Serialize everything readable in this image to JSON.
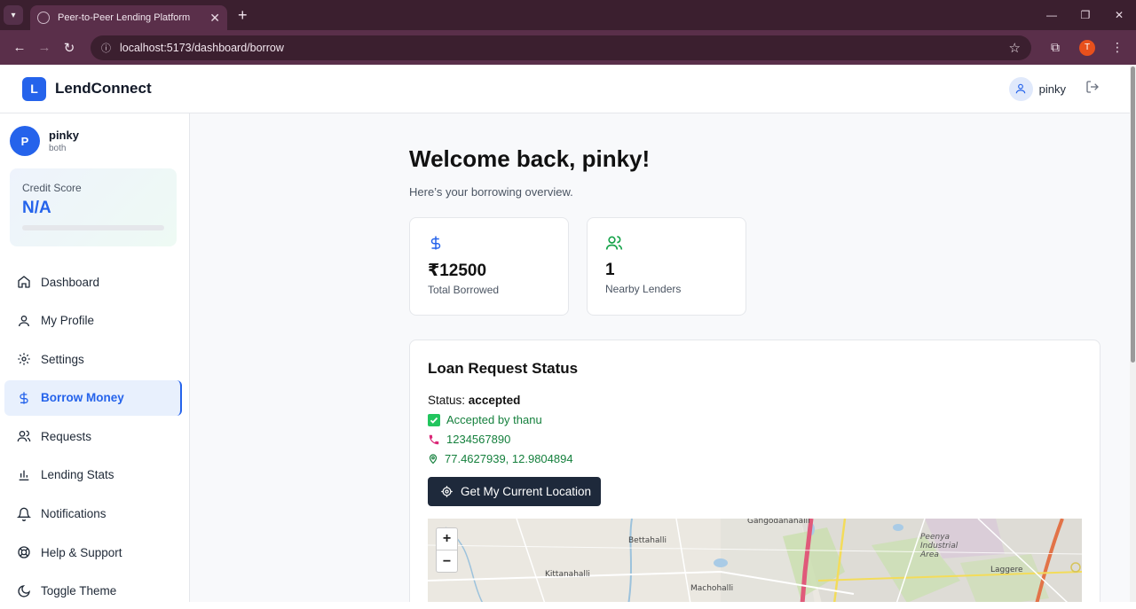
{
  "browser": {
    "tab_title": "Peer-to-Peer Lending Platform",
    "url": "localhost:5173/dashboard/borrow",
    "profile_initial": "T"
  },
  "topnav": {
    "logo_letter": "L",
    "brand": "LendConnect",
    "username": "pinky"
  },
  "sidebar": {
    "avatar_initial": "P",
    "username": "pinky",
    "role": "both",
    "credit": {
      "label": "Credit Score",
      "value": "N/A",
      "fill_fraction": 0
    },
    "items": [
      {
        "label": "Dashboard",
        "icon": "home-icon"
      },
      {
        "label": "My Profile",
        "icon": "user-icon"
      },
      {
        "label": "Settings",
        "icon": "gear-icon"
      },
      {
        "label": "Borrow Money",
        "icon": "dollar-icon"
      },
      {
        "label": "Requests",
        "icon": "users-icon"
      },
      {
        "label": "Lending Stats",
        "icon": "bar-chart-icon"
      },
      {
        "label": "Notifications",
        "icon": "bell-icon"
      },
      {
        "label": "Help & Support",
        "icon": "lifebuoy-icon"
      },
      {
        "label": "Toggle Theme",
        "icon": "moon-icon"
      }
    ],
    "active_item": "Borrow Money"
  },
  "main": {
    "welcome": "Welcome back, pinky!",
    "subtitle": "Here’s your borrowing overview.",
    "stats": [
      {
        "value": "₹12500",
        "label": "Total Borrowed",
        "icon": "dollar-icon",
        "color": "#2563eb"
      },
      {
        "value": "1",
        "label": "Nearby Lenders",
        "icon": "users-icon",
        "color": "#16a34a"
      }
    ],
    "loan_status": {
      "title": "Loan Request Status",
      "status_prefix": "Status:",
      "status_value": "accepted",
      "accepted_by": "Accepted by thanu",
      "phone": "1234567890",
      "coords": "77.4627939, 12.9804894",
      "location_button": "Get My Current Location"
    },
    "map": {
      "zoom_in": "+",
      "zoom_out": "−",
      "labels": [
        "Gangodanahalli",
        "Bettahalli",
        "Kittanahalli",
        "Machohalli",
        "Peenya Industrial Area",
        "Laggere"
      ]
    }
  },
  "colors": {
    "accent": "#2563eb",
    "success": "#15803d",
    "chrome": "#5a2f4a",
    "button_dark": "#1e293b"
  }
}
